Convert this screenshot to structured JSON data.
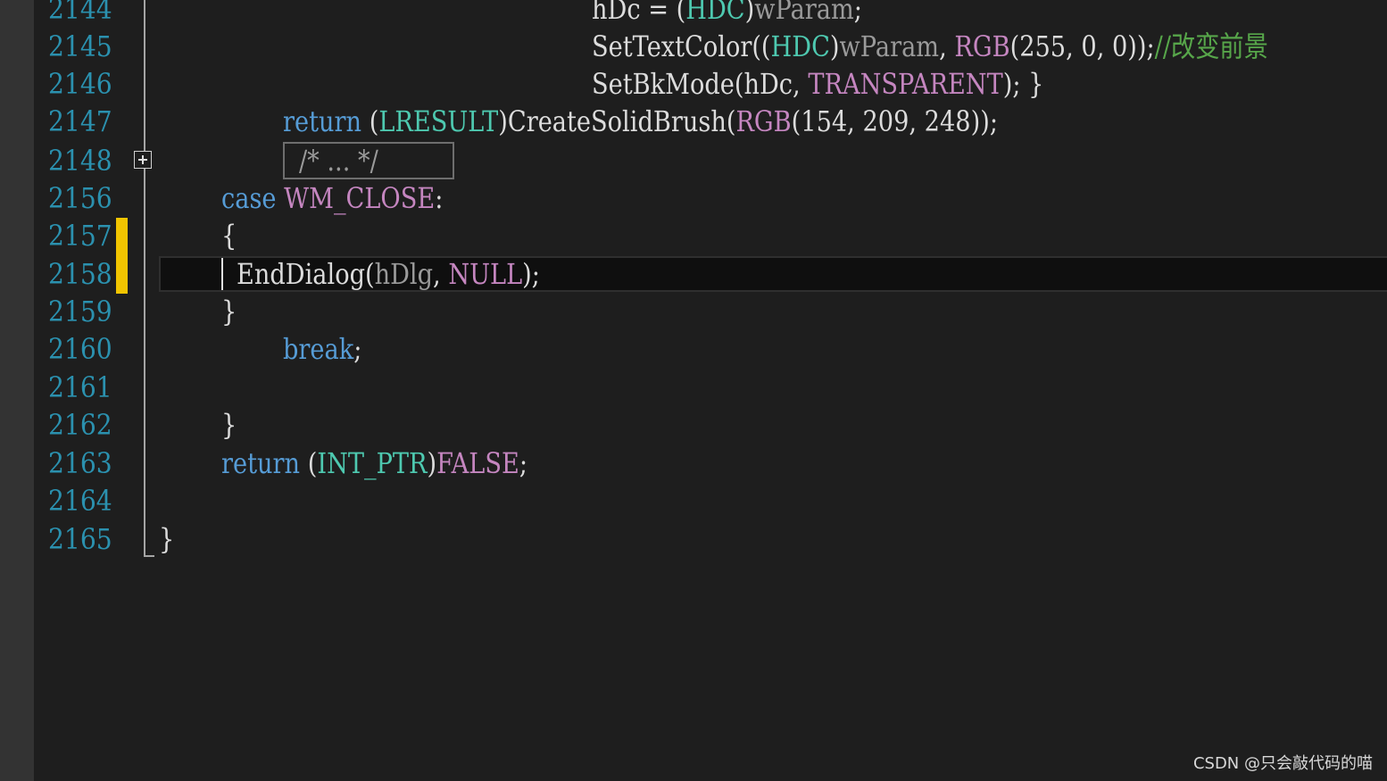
{
  "editor": {
    "lines": [
      {
        "number": "2144",
        "tokens": [
          {
            "t": "hDc = ",
            "c": "txt"
          },
          {
            "t": "(",
            "c": "txt"
          },
          {
            "t": "HDC",
            "c": "ty"
          },
          {
            "t": ")",
            "c": "txt"
          },
          {
            "t": "wParam",
            "c": "par"
          },
          {
            "t": ";",
            "c": "txt"
          }
        ]
      },
      {
        "number": "2145",
        "tokens": [
          {
            "t": "SetTextColor",
            "c": "txt"
          },
          {
            "t": "((",
            "c": "txt"
          },
          {
            "t": "HDC",
            "c": "ty"
          },
          {
            "t": ")",
            "c": "txt"
          },
          {
            "t": "wParam",
            "c": "par"
          },
          {
            "t": ", ",
            "c": "txt"
          },
          {
            "t": "RGB",
            "c": "macp"
          },
          {
            "t": "(255, 0, 0));",
            "c": "txt"
          },
          {
            "t": "//改变前景",
            "c": "cm"
          }
        ]
      },
      {
        "number": "2146",
        "tokens": [
          {
            "t": "SetBkMode",
            "c": "txt"
          },
          {
            "t": "(hDc, ",
            "c": "txt"
          },
          {
            "t": "TRANSPARENT",
            "c": "macp"
          },
          {
            "t": "); }",
            "c": "txt"
          }
        ]
      },
      {
        "number": "2147",
        "tokens": [
          {
            "t": "return ",
            "c": "kw"
          },
          {
            "t": "(",
            "c": "txt"
          },
          {
            "t": "LRESULT",
            "c": "ty"
          },
          {
            "t": ")",
            "c": "txt"
          },
          {
            "t": "CreateSolidBrush",
            "c": "txt"
          },
          {
            "t": "(",
            "c": "txt"
          },
          {
            "t": "RGB",
            "c": "macp"
          },
          {
            "t": "(154, 209, 248));",
            "c": "txt"
          }
        ]
      },
      {
        "number": "2148",
        "tokens": [
          {
            "t": "/* ... */",
            "c": "par"
          }
        ]
      },
      {
        "number": "2156",
        "tokens": [
          {
            "t": "case ",
            "c": "kw"
          },
          {
            "t": "WM_CLOSE",
            "c": "macp"
          },
          {
            "t": ":",
            "c": "txt"
          }
        ]
      },
      {
        "number": "2157",
        "tokens": [
          {
            "t": "{",
            "c": "txt"
          }
        ]
      },
      {
        "number": "2158",
        "tokens": [
          {
            "t": "EndDialog",
            "c": "txt"
          },
          {
            "t": "(",
            "c": "txt"
          },
          {
            "t": "hDlg",
            "c": "par"
          },
          {
            "t": ", ",
            "c": "txt"
          },
          {
            "t": "NULL",
            "c": "macp"
          },
          {
            "t": ");",
            "c": "txt"
          }
        ]
      },
      {
        "number": "2159",
        "tokens": [
          {
            "t": "}",
            "c": "txt"
          }
        ]
      },
      {
        "number": "2160",
        "tokens": [
          {
            "t": "break",
            "c": "kw"
          },
          {
            "t": ";",
            "c": "txt"
          }
        ]
      },
      {
        "number": "2161",
        "tokens": []
      },
      {
        "number": "2162",
        "tokens": [
          {
            "t": "}",
            "c": "txt"
          }
        ]
      },
      {
        "number": "2163",
        "tokens": [
          {
            "t": "return ",
            "c": "kw"
          },
          {
            "t": "(",
            "c": "txt"
          },
          {
            "t": "INT_PTR",
            "c": "ty"
          },
          {
            "t": ")",
            "c": "txt"
          },
          {
            "t": "FALSE",
            "c": "macp"
          },
          {
            "t": ";",
            "c": "txt"
          }
        ]
      },
      {
        "number": "2164",
        "tokens": []
      },
      {
        "number": "2165",
        "tokens": [
          {
            "t": "}",
            "c": "txt"
          }
        ]
      }
    ],
    "collapsed_icon": "plus-box-icon",
    "change_marker_color": "#f2c500",
    "line_number_color": "#2b91af"
  },
  "watermark": "CSDN @只会敲代码的喵"
}
